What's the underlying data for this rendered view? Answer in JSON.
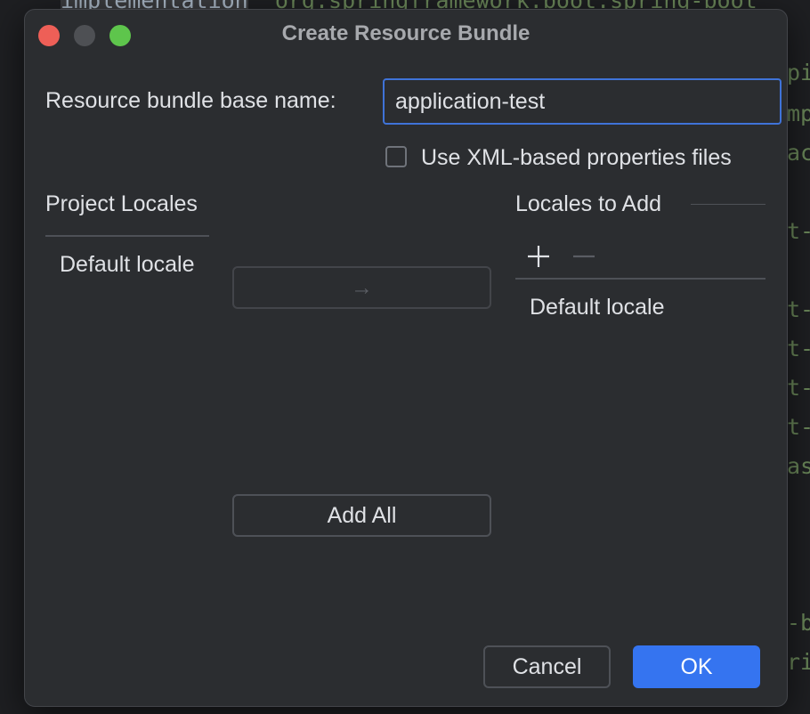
{
  "background": {
    "top_code_keyword": "implementation",
    "top_code_string": "'org.springframework.boot:spring-boot",
    "side_fragments": [
      "pi",
      "mp",
      "ac",
      "t-",
      "t-",
      "t-",
      "t-",
      "t-",
      "as",
      "-b",
      "ri"
    ]
  },
  "dialog": {
    "title": "Create Resource Bundle",
    "base_name_label": "Resource bundle base name:",
    "base_name_value": "application-test",
    "xml_checkbox_label": "Use XML-based properties files",
    "xml_checkbox_checked": false,
    "project_locales": {
      "header": "Project Locales",
      "items": [
        "Default locale"
      ]
    },
    "move_button_glyph": "→",
    "add_all_label": "Add All",
    "locales_to_add": {
      "header": "Locales to Add",
      "add_glyph": "+",
      "remove_glyph": "−",
      "items": [
        "Default locale"
      ]
    },
    "cancel_label": "Cancel",
    "ok_label": "OK"
  },
  "colors": {
    "primary": "#3574f0",
    "focus_border": "#3f73d8",
    "close": "#ee5f57",
    "maximize": "#5ec54c"
  }
}
